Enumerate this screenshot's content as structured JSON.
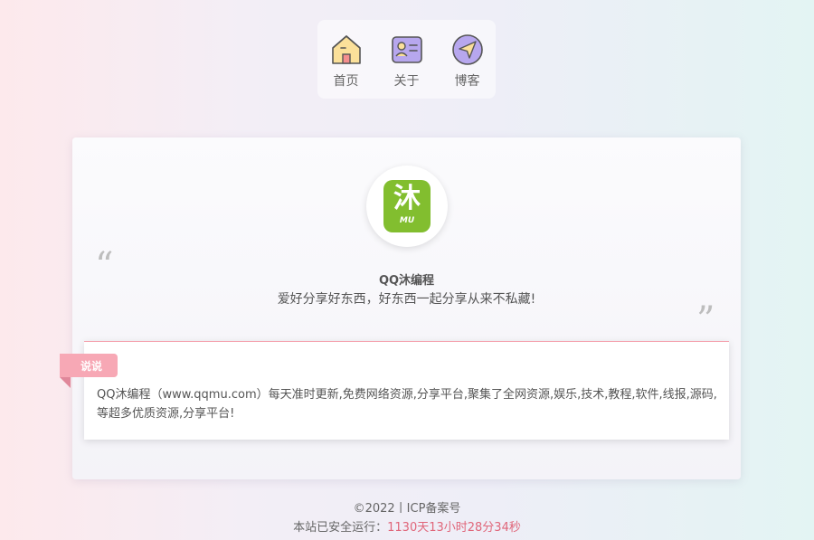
{
  "nav": {
    "items": [
      {
        "label": "首页",
        "icon": "home-icon"
      },
      {
        "label": "关于",
        "icon": "id-card-icon"
      },
      {
        "label": "博客",
        "icon": "navigation-arrow-icon"
      }
    ]
  },
  "profile": {
    "logo_main": "沐",
    "logo_sub": "MU",
    "name": "QQ沐编程",
    "motto": "爱好分享好东西，好东西一起分享从来不私藏!",
    "quote_open": "“",
    "quote_close": "”"
  },
  "shuoshuo": {
    "tag": "说说",
    "text": "QQ沐编程（www.qqmu.com）每天准时更新,免费网络资源,分享平台,聚集了全网资源,娱乐,技术,教程,软件,线报,源码,等超多优质资源,分享平台!"
  },
  "footer": {
    "copyright": "©2022丨ICP备案号",
    "runtime_label": "本站已安全运行：",
    "runtime_value": "1130天13小时28分34秒"
  },
  "colors": {
    "accent_pink": "#f7a8b5",
    "logo_green": "#82be2f",
    "uptime_red": "#e0667a"
  }
}
